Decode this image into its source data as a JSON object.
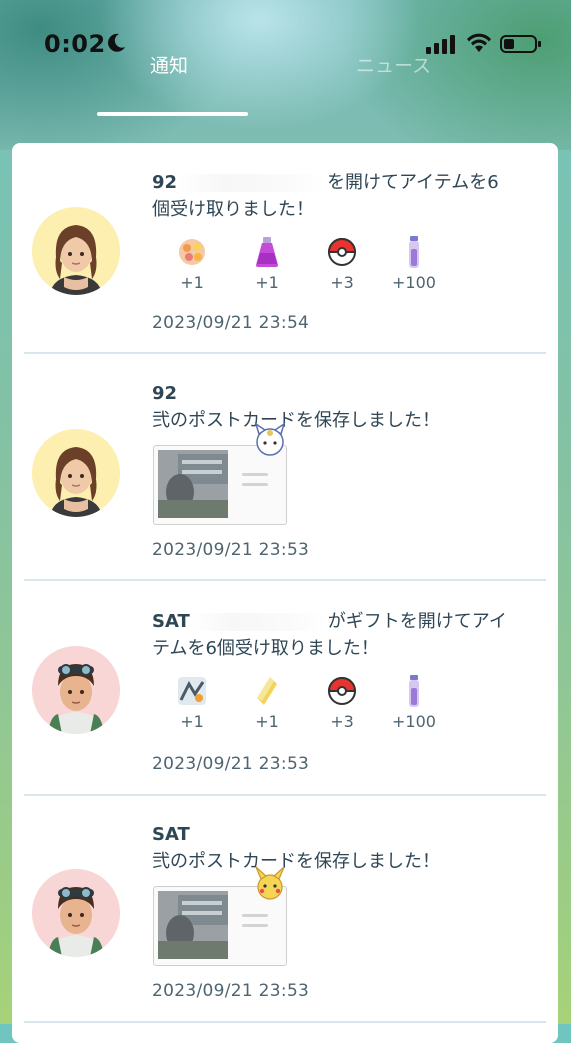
{
  "status_bar": {
    "time": "0:02",
    "icons": [
      "moon-icon",
      "signal-icon",
      "wifi-icon",
      "battery-icon"
    ]
  },
  "tabs": [
    {
      "label": "通知",
      "active": true
    },
    {
      "label": "ニュース",
      "active": false
    }
  ],
  "notifications": [
    {
      "type": "gift",
      "name": "92",
      "text": "を開けてアイテムを6個受け取りました！",
      "items": [
        {
          "icon": "star-piece-icon",
          "count": "+1"
        },
        {
          "icon": "potion-icon",
          "count": "+1"
        },
        {
          "icon": "pokeball-icon",
          "count": "+3"
        },
        {
          "icon": "stardust-vial-icon",
          "count": "+100"
        }
      ],
      "date": "2023/09/21 23:54",
      "avatar": "female-trainer"
    },
    {
      "type": "postcard",
      "name": "92",
      "text": "弐のポストカードを保存しました！",
      "date": "2023/09/21 23:53",
      "avatar": "female-trainer"
    },
    {
      "type": "gift",
      "name": "SAT",
      "text": "がギフトを開けてアイテムを6個受け取りました！",
      "items": [
        {
          "icon": "egg-incubator-icon",
          "count": "+1"
        },
        {
          "icon": "golden-berry-icon",
          "count": "+1"
        },
        {
          "icon": "pokeball-icon",
          "count": "+3"
        },
        {
          "icon": "stardust-vial-icon",
          "count": "+100"
        }
      ],
      "date": "2023/09/21 23:53",
      "avatar": "male-trainer"
    },
    {
      "type": "postcard",
      "name": "SAT",
      "text": "弐のポストカードを保存しました！",
      "date": "2023/09/21 23:53",
      "avatar": "male-trainer"
    }
  ],
  "colors": {
    "card_bg": "#ffffff",
    "text": "#2f4654",
    "subtext": "#4e6470",
    "divider": "#d8e7ec",
    "female_avatar_bg": "#fcefb0",
    "male_avatar_bg": "#f9d6d6"
  }
}
